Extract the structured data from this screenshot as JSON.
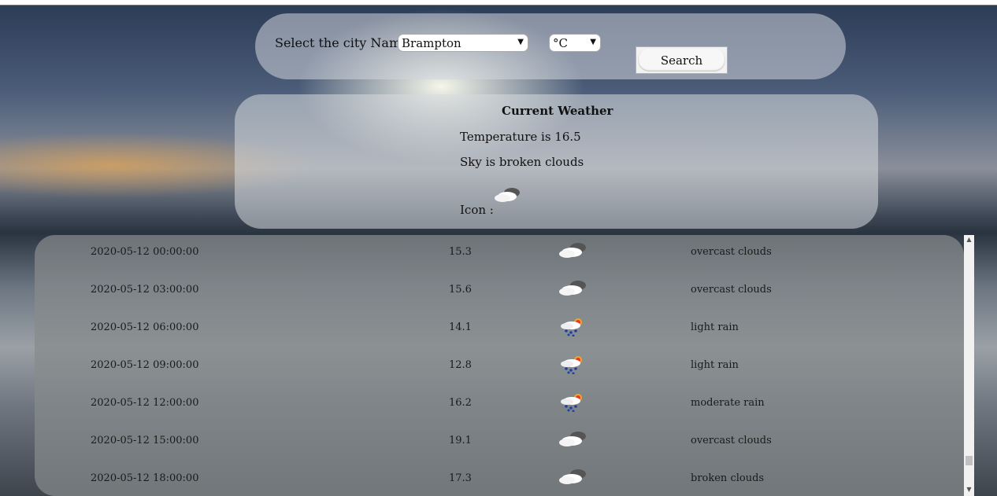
{
  "search": {
    "label": "Select the city Name :",
    "city_value": "Brampton",
    "unit_value": "°C",
    "button_label": "Search"
  },
  "current": {
    "title": "Current Weather",
    "temperature": "Temperature is 16.5",
    "sky": "Sky is broken clouds",
    "icon_label": "Icon :",
    "icon": "broken-clouds-icon"
  },
  "forecast": [
    {
      "date": "2020-05-12 00:00:00",
      "temp": "15.3",
      "icon": "overcast-clouds-icon",
      "desc": "overcast clouds"
    },
    {
      "date": "2020-05-12 03:00:00",
      "temp": "15.6",
      "icon": "overcast-clouds-icon",
      "desc": "overcast clouds"
    },
    {
      "date": "2020-05-12 06:00:00",
      "temp": "14.1",
      "icon": "rain-icon",
      "desc": "light rain"
    },
    {
      "date": "2020-05-12 09:00:00",
      "temp": "12.8",
      "icon": "rain-icon",
      "desc": "light rain"
    },
    {
      "date": "2020-05-12 12:00:00",
      "temp": "16.2",
      "icon": "rain-icon",
      "desc": "moderate rain"
    },
    {
      "date": "2020-05-12 15:00:00",
      "temp": "19.1",
      "icon": "overcast-clouds-icon",
      "desc": "overcast clouds"
    },
    {
      "date": "2020-05-12 18:00:00",
      "temp": "17.3",
      "icon": "broken-clouds-icon",
      "desc": "broken clouds"
    }
  ],
  "colors": {
    "panel": "#d6d9dd",
    "forecast_panel": "#87898b",
    "rain_drop": "#1f3fa0",
    "sun": "#f5a623"
  }
}
